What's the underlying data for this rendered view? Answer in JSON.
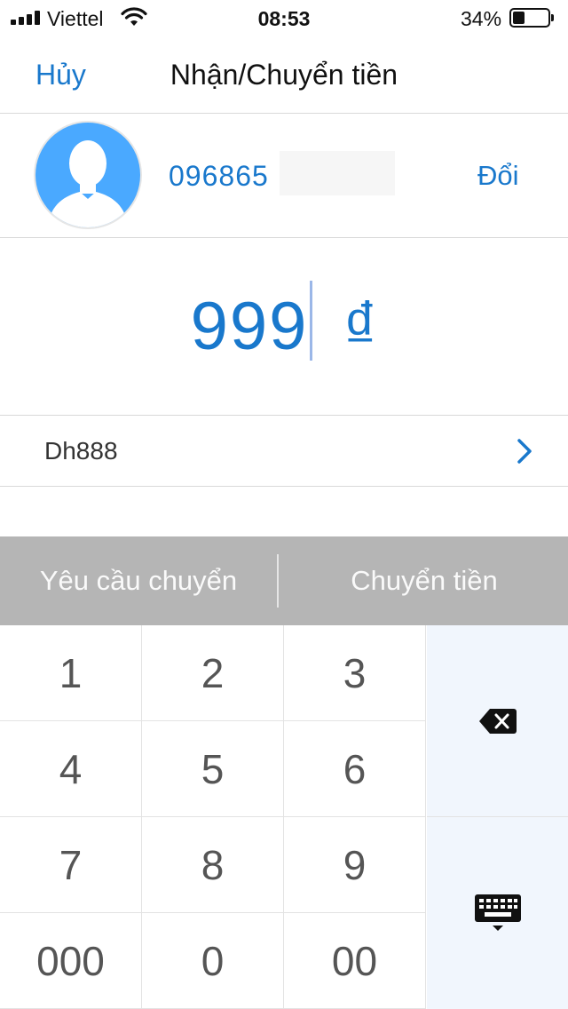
{
  "status_bar": {
    "carrier": "Viettel",
    "time": "08:53",
    "battery_percent": "34%",
    "battery_level": 0.34
  },
  "nav": {
    "cancel_label": "Hủy",
    "title": "Nhận/Chuyển tiền"
  },
  "contact": {
    "phone": "096865",
    "change_label": "Đổi"
  },
  "amount": {
    "value": "999",
    "currency": "₫"
  },
  "note": {
    "text": "Dh888"
  },
  "actions": {
    "request_label": "Yêu cầu chuyển",
    "transfer_label": "Chuyển tiền"
  },
  "keypad": {
    "keys": [
      "1",
      "2",
      "3",
      "4",
      "5",
      "6",
      "7",
      "8",
      "9",
      "000",
      "0",
      "00"
    ]
  },
  "colors": {
    "accent": "#1978cc",
    "action_bar": "#b5b5b5",
    "side_keys": "#f1f6fd"
  }
}
